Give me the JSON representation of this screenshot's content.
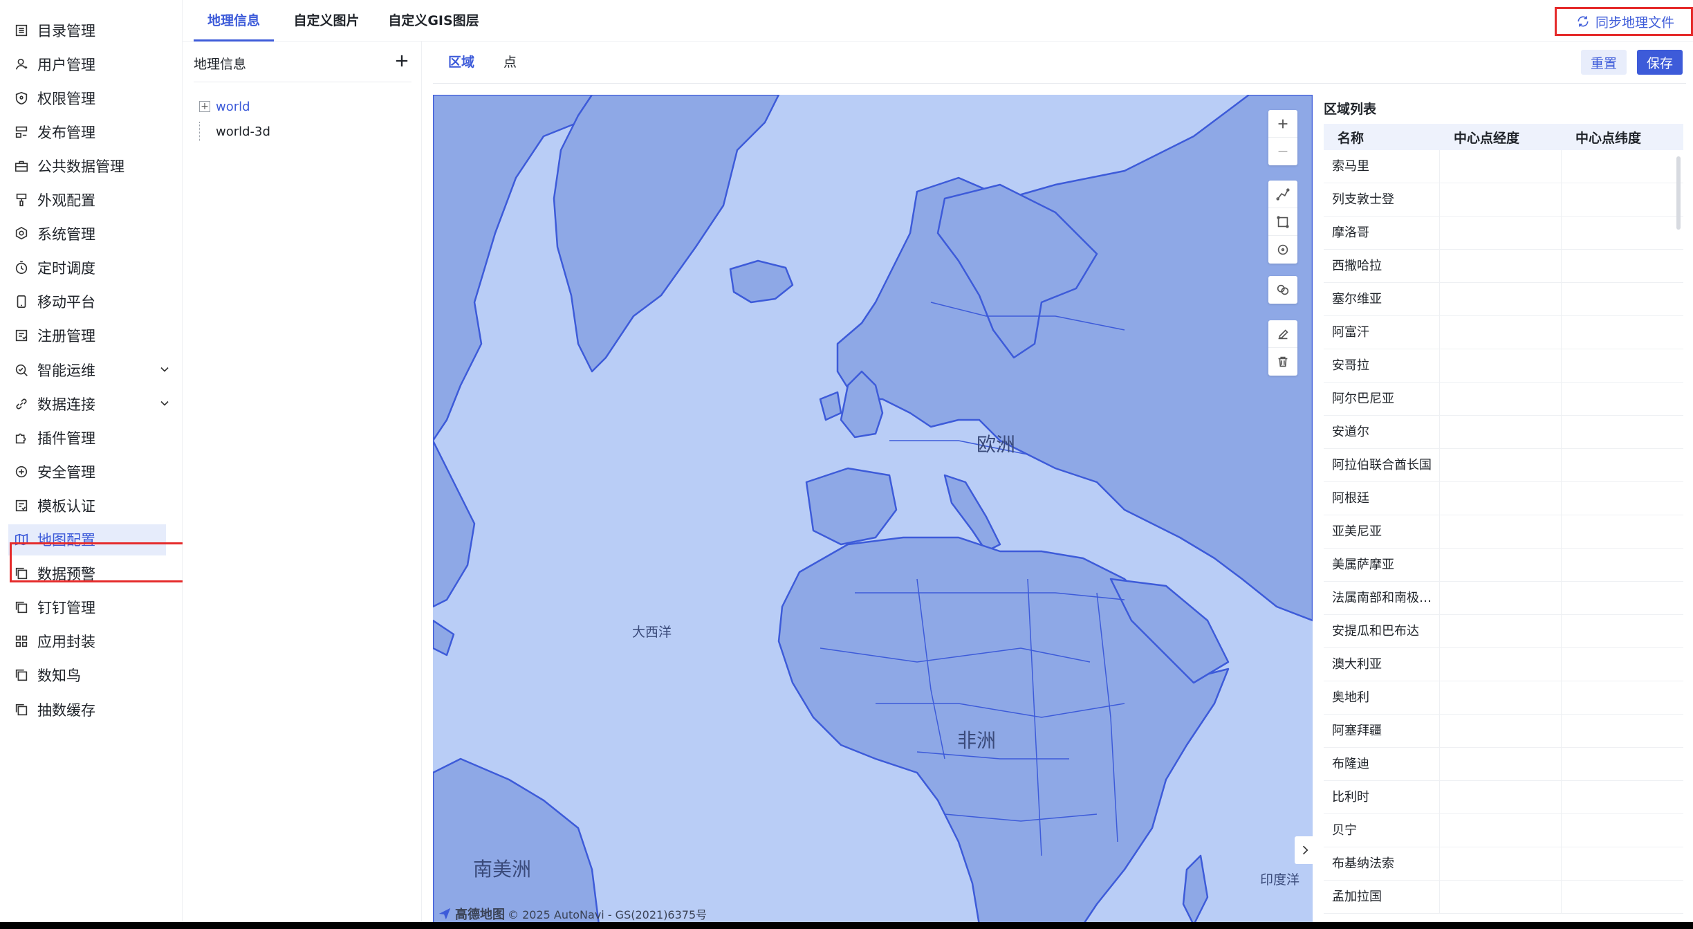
{
  "sidebar": {
    "items": [
      {
        "label": "目录管理",
        "icon": "list-icon"
      },
      {
        "label": "用户管理",
        "icon": "user-icon"
      },
      {
        "label": "权限管理",
        "icon": "shield-icon"
      },
      {
        "label": "发布管理",
        "icon": "publish-icon"
      },
      {
        "label": "公共数据管理",
        "icon": "briefcase-icon"
      },
      {
        "label": "外观配置",
        "icon": "brush-icon"
      },
      {
        "label": "系统管理",
        "icon": "gear-icon"
      },
      {
        "label": "定时调度",
        "icon": "timer-icon"
      },
      {
        "label": "移动平台",
        "icon": "mobile-icon"
      },
      {
        "label": "注册管理",
        "icon": "register-icon"
      },
      {
        "label": "智能运维",
        "icon": "ops-icon"
      },
      {
        "label": "数据连接",
        "icon": "link-icon"
      },
      {
        "label": "插件管理",
        "icon": "puzzle-icon"
      },
      {
        "label": "安全管理",
        "icon": "security-icon"
      },
      {
        "label": "模板认证",
        "icon": "template-icon"
      },
      {
        "label": "地图配置",
        "icon": "map-icon"
      },
      {
        "label": "数据预警",
        "icon": "copy-icon"
      },
      {
        "label": "钉钉管理",
        "icon": "copy-icon"
      },
      {
        "label": "应用封装",
        "icon": "grid-icon"
      },
      {
        "label": "数知鸟",
        "icon": "copy-icon"
      },
      {
        "label": "抽数缓存",
        "icon": "copy-icon"
      }
    ],
    "active_index": 15
  },
  "topbar": {
    "tabs": [
      "地理信息",
      "自定义图片",
      "自定义GIS图层"
    ],
    "active_index": 0,
    "sync_label": "同步地理文件"
  },
  "tree": {
    "title": "地理信息",
    "nodes": [
      "world",
      "world-3d"
    ]
  },
  "main": {
    "subtabs": [
      "区域",
      "点"
    ],
    "active_subtab": 0,
    "reset_label": "重置",
    "save_label": "保存"
  },
  "map": {
    "labels": {
      "europe": "欧洲",
      "atlantic": "大西洋",
      "africa": "非洲",
      "south_america": "南美洲",
      "indian_ocean": "印度洋"
    },
    "attribution_brand": "高德地图",
    "attribution_text": "© 2025 AutoNavi - GS(2021)6375号",
    "colors": {
      "water": "#b9cdf6",
      "land": "#8ea8e6",
      "border": "#3d5bd9"
    }
  },
  "region_list": {
    "title": "区域列表",
    "columns": [
      "名称",
      "中心点经度",
      "中心点纬度"
    ],
    "rows": [
      "索马里",
      "列支敦士登",
      "摩洛哥",
      "西撒哈拉",
      "塞尔维亚",
      "阿富汗",
      "安哥拉",
      "阿尔巴尼亚",
      "安道尔",
      "阿拉伯联合酋长国",
      "阿根廷",
      "亚美尼亚",
      "美属萨摩亚",
      "法属南部和南极…",
      "安提瓜和巴布达",
      "澳大利亚",
      "奥地利",
      "阿塞拜疆",
      "布隆迪",
      "比利时",
      "贝宁",
      "布基纳法索",
      "孟加拉国"
    ]
  }
}
